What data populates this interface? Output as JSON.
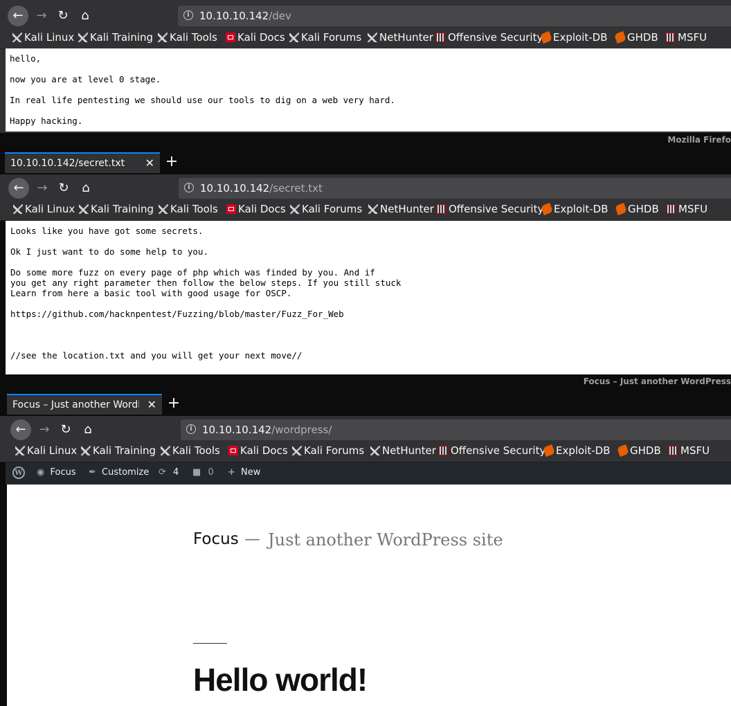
{
  "bookmarks": [
    {
      "label": "Kali Linux",
      "icon": "kali-dragon-icon"
    },
    {
      "label": "Kali Training",
      "icon": "kali-dragon-icon"
    },
    {
      "label": "Kali Tools",
      "icon": "kali-dragon-icon"
    },
    {
      "label": "Kali Docs",
      "icon": "kali-docs-icon"
    },
    {
      "label": "Kali Forums",
      "icon": "kali-dragon-icon"
    },
    {
      "label": "NetHunter",
      "icon": "kali-dragon-icon"
    },
    {
      "label": "Offensive Security",
      "icon": "offensive-security-icon"
    },
    {
      "label": "Exploit-DB",
      "icon": "exploit-db-icon"
    },
    {
      "label": "GHDB",
      "icon": "exploit-db-icon"
    },
    {
      "label": "MSFU",
      "icon": "offensive-security-icon"
    }
  ],
  "win1": {
    "url_host": "10.10.10.142",
    "url_path": "/dev",
    "lines": [
      "hello,",
      "",
      "now you are at level 0 stage.",
      "",
      "In real life pentesting we should use our tools to dig on a web very hard.",
      "",
      "Happy hacking."
    ]
  },
  "win2": {
    "window_title": "Mozilla Firefo",
    "tab_title": "10.10.10.142/secret.txt",
    "url_host": "10.10.10.142",
    "url_path": "/secret.txt",
    "lines": [
      "Looks like you have got some secrets.",
      "",
      "Ok I just want to do some help to you.",
      "",
      "Do some more fuzz on every page of php which was finded by you. And if",
      "you get any right parameter then follow the below steps. If you still stuck",
      "Learn from here a basic tool with good usage for OSCP.",
      "",
      "https://github.com/hacknpentest/Fuzzing/blob/master/Fuzz_For_Web",
      "",
      "",
      "",
      "//see the location.txt and you will get your next move//"
    ]
  },
  "win3": {
    "window_title": "Focus – Just another WordPress",
    "tab_title": "Focus – Just another WordP",
    "url_host": "10.10.10.142",
    "url_path": "/wordpress/",
    "adminbar": {
      "site": "Focus",
      "customize": "Customize",
      "updates": "4",
      "comments": "0",
      "new": "New"
    },
    "site_title": "Focus",
    "site_sep": "—",
    "site_description": "Just another WordPress site",
    "post_title": "Hello world!"
  }
}
